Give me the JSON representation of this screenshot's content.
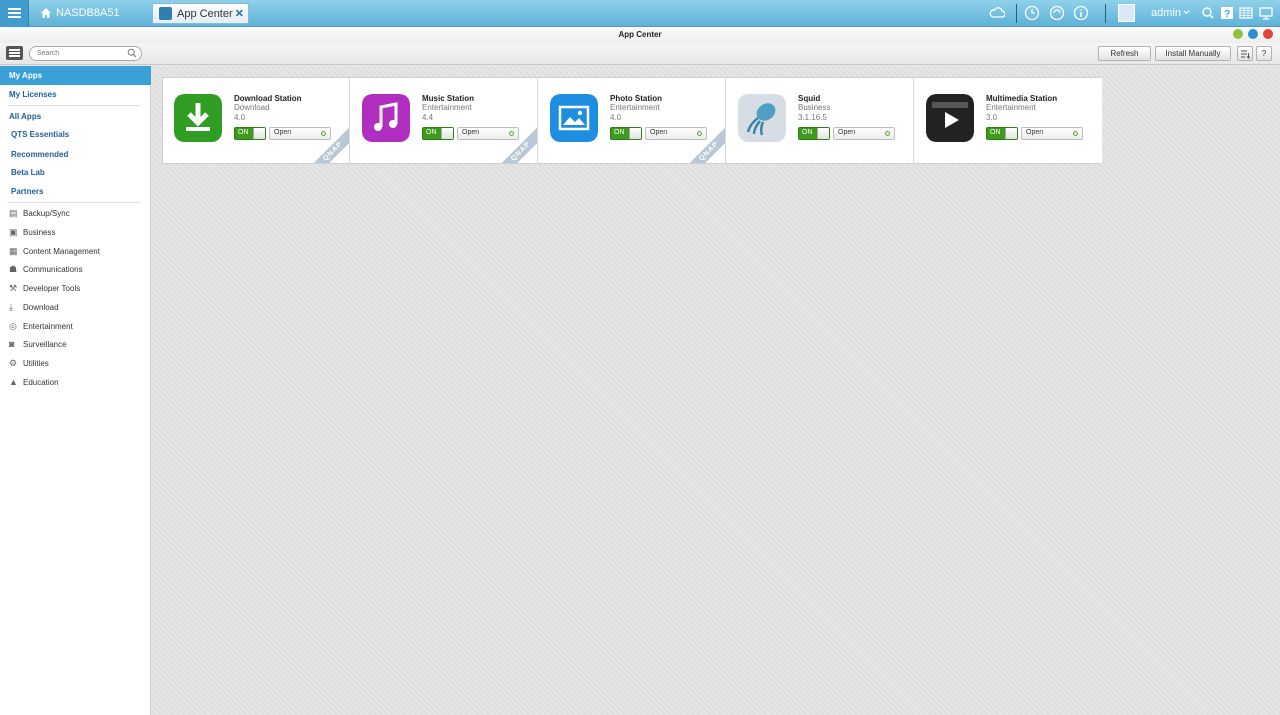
{
  "topbar": {
    "home_label": "NASDB8A51",
    "tab_label": "App Center",
    "user_label": "admin"
  },
  "window": {
    "title": "App Center"
  },
  "toolbar": {
    "search_placeholder": "Search",
    "refresh_label": "Refresh",
    "install_label": "Install Manually",
    "help_label": "?"
  },
  "sidebar": {
    "my_apps": "My Apps",
    "my_licenses": "My Licenses",
    "all_apps": "All Apps",
    "sub_items": [
      "QTS Essentials",
      "Recommended",
      "Beta Lab",
      "Partners"
    ],
    "categories": [
      {
        "label": "Backup/Sync",
        "icon": "backup-icon"
      },
      {
        "label": "Business",
        "icon": "briefcase-icon"
      },
      {
        "label": "Content Management",
        "icon": "content-icon"
      },
      {
        "label": "Communications",
        "icon": "communications-icon"
      },
      {
        "label": "Developer Tools",
        "icon": "hammer-icon"
      },
      {
        "label": "Download",
        "icon": "download-icon"
      },
      {
        "label": "Entertainment",
        "icon": "entertainment-icon"
      },
      {
        "label": "Surveillance",
        "icon": "camera-icon"
      },
      {
        "label": "Utilities",
        "icon": "wrench-icon"
      },
      {
        "label": "Education",
        "icon": "graduation-cap-icon"
      }
    ]
  },
  "apps": [
    {
      "name": "Download Station",
      "category": "Download",
      "version": "4.0",
      "toggle": "ON",
      "open": "Open",
      "ribbon": "QNAP",
      "color": "#2f9e22"
    },
    {
      "name": "Music Station",
      "category": "Entertainment",
      "version": "4.4",
      "toggle": "ON",
      "open": "Open",
      "ribbon": "QNAP",
      "color": "#b02fc0"
    },
    {
      "name": "Photo Station",
      "category": "Entertainment",
      "version": "4.0",
      "toggle": "ON",
      "open": "Open",
      "ribbon": "QNAP",
      "color": "#1e8ee0"
    },
    {
      "name": "Squid",
      "category": "Business",
      "version": "3.1.16.5",
      "toggle": "ON",
      "open": "Open",
      "color": "#d7dde4"
    },
    {
      "name": "Multimedia Station",
      "category": "Entertainment",
      "version": "3.0",
      "toggle": "ON",
      "open": "Open",
      "color": "#222222"
    }
  ]
}
